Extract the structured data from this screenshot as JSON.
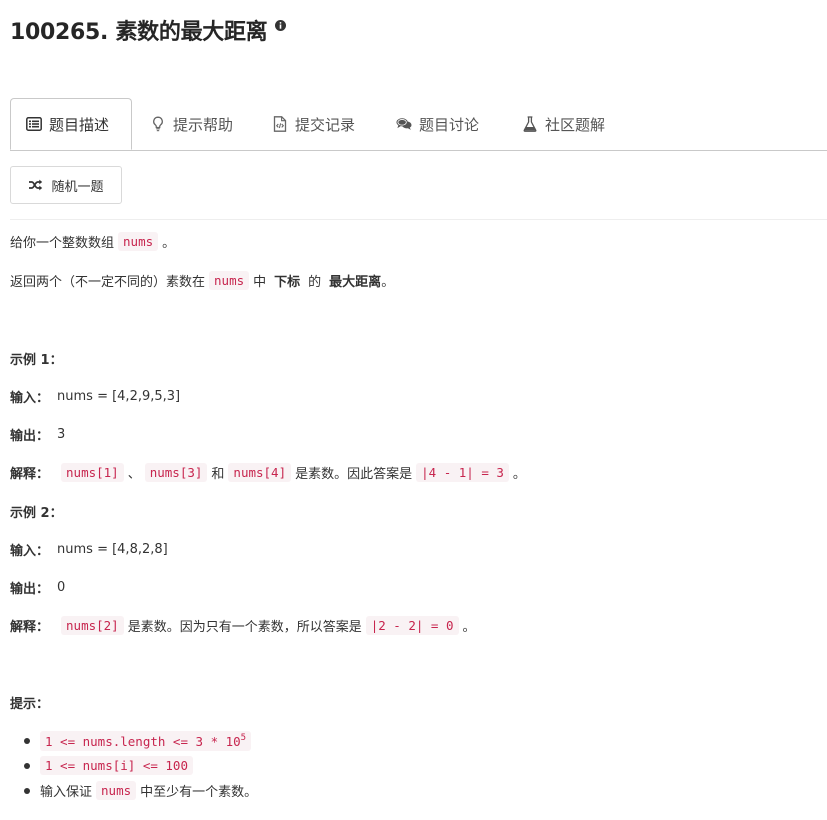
{
  "problem": {
    "title": "100265. 素数的最大距离"
  },
  "tabs": [
    {
      "label": "题目描述",
      "icon": "list-icon"
    },
    {
      "label": "提示帮助",
      "icon": "lightbulb-icon"
    },
    {
      "label": "提交记录",
      "icon": "code-file-icon"
    },
    {
      "label": "题目讨论",
      "icon": "comments-icon"
    },
    {
      "label": "社区题解",
      "icon": "flask-icon"
    }
  ],
  "random_button": {
    "label": "随机一题",
    "icon": "shuffle-icon"
  },
  "description": {
    "p1_prefix": "给你一个整数数组",
    "p1_code": "nums",
    "p1_suffix": "。",
    "p2_prefix": "返回两个（不一定不同的）素数在",
    "p2_code": "nums",
    "p2_mid": "中",
    "p2_bold1": "下标",
    "p2_mid2": "的",
    "p2_bold2": "最大距离",
    "p2_suffix": "。"
  },
  "examples": [
    {
      "title": "示例 1：",
      "input_label": "输入：",
      "input": "nums = [4,2,9,5,3]",
      "output_label": "输出：",
      "output": "3",
      "explain_label": "解释：",
      "code1": "nums[1]",
      "sep1": "、",
      "code2": "nums[3]",
      "sep2": "和",
      "code3": "nums[4]",
      "text": "是素数。因此答案是",
      "code4": "|4 - 1| = 3",
      "end": "。"
    },
    {
      "title": "示例 2：",
      "input_label": "输入：",
      "input": "nums = [4,8,2,8]",
      "output_label": "输出：",
      "output": "0",
      "explain_label": "解释：",
      "code1": "nums[2]",
      "text": "是素数。因为只有一个素数，所以答案是",
      "code2": "|2 - 2| = 0",
      "end": "。"
    }
  ],
  "constraints": {
    "title": "提示：",
    "c1_code": "1 <= nums.length <= 3 * 10",
    "c1_sup": "5",
    "c2_code": "1 <= nums[i] <= 100",
    "c3_prefix": "输入保证",
    "c3_code": "nums",
    "c3_suffix": "中至少有一个素数。"
  }
}
